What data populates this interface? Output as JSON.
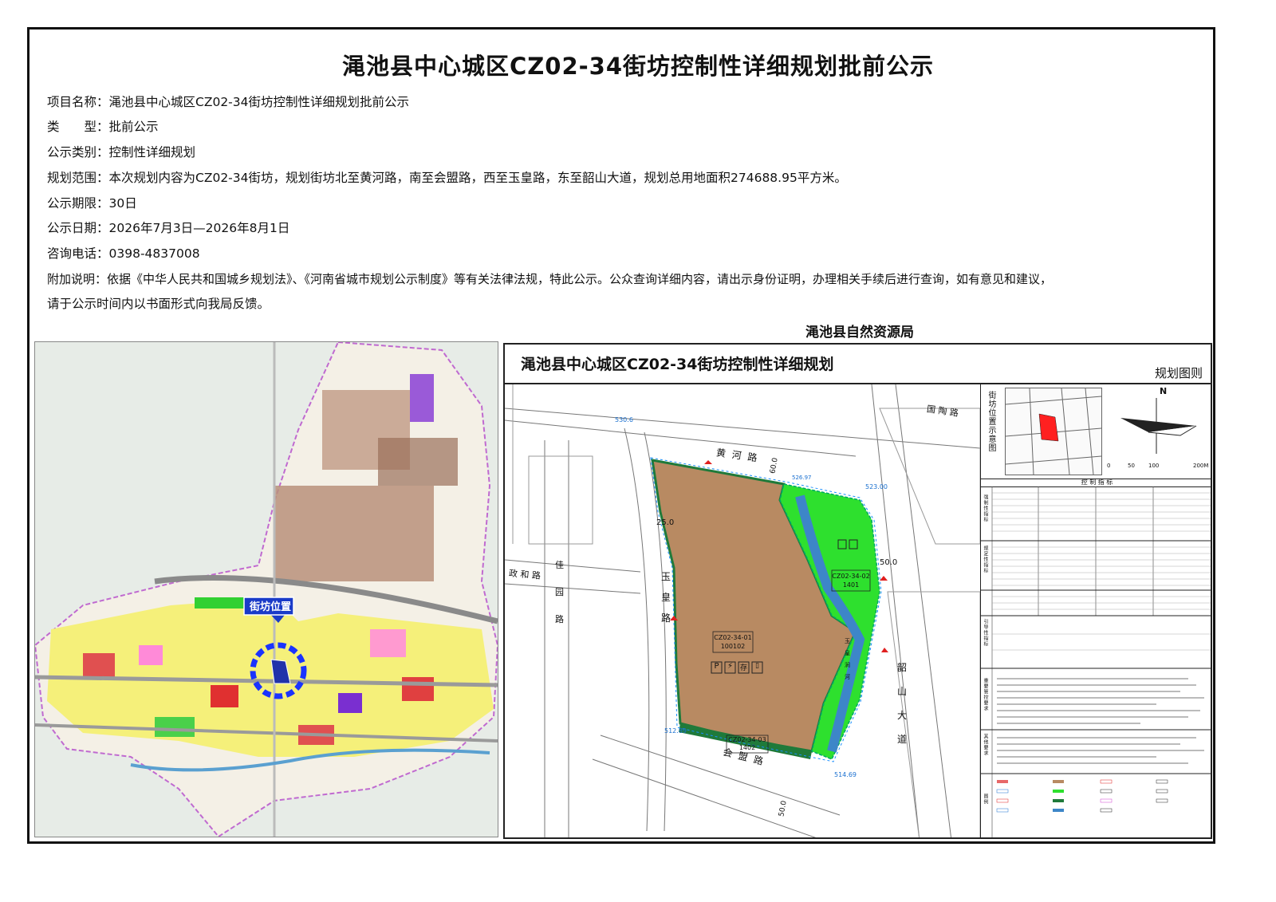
{
  "title": "渑池县中心城区CZ02-34街坊控制性详细规划批前公示",
  "info": [
    {
      "label": "项目名称：",
      "value": "渑池县中心城区CZ02-34街坊控制性详细规划批前公示"
    },
    {
      "label": "类　　型：",
      "value": "批前公示"
    },
    {
      "label": "公示类别：",
      "value": "控制性详细规划"
    },
    {
      "label": "规划范围：",
      "value": "本次规划内容为CZ02-34街坊，规划街坊北至黄河路，南至会盟路，西至玉皇路，东至韶山大道，规划总用地面积274688.95平方米。"
    },
    {
      "label": "公示期限：",
      "value": "30日"
    },
    {
      "label": "公示日期：",
      "value": "2026年7月3日—2026年8月1日"
    },
    {
      "label": "咨询电话：",
      "value": "0398-4837008"
    },
    {
      "label": "附加说明：",
      "value": "依据《中华人民共和国城乡规划法》、《河南省城市规划公示制度》等有关法律法规，特此公示。公众查询详细内容，请出示身份证明，办理相关手续后进行查询，如有意见和建议，"
    },
    {
      "label": "",
      "value": "请于公示时间内以书面形式向我局反馈。"
    }
  ],
  "authority": "渑池县自然资源局",
  "location_map": {
    "label": "街坊位置"
  },
  "panel": {
    "title": "渑池县中心城区CZ02-34街坊控制性详细规划",
    "subtitle": "规划图则",
    "roads": {
      "north": "黄 河 路",
      "south": "会 盟 路",
      "west": "玉 皇 路",
      "east": "韶 山 大 道",
      "northeast": "国 陶 路",
      "west_road": "政 和 路",
      "west_vertical": "佳 园 路",
      "river": "玉 皇 涧 河"
    },
    "widths": {
      "north": "60.0",
      "east": "50.0",
      "west": "25.0",
      "south": "50.0"
    },
    "elevations": [
      "530.6",
      "523.00",
      "512.89",
      "514.69",
      "526.97"
    ],
    "parcels": [
      {
        "code": "CZ02-34-01",
        "use": "100102"
      },
      {
        "code": "CZ02-34-02",
        "use": "1401"
      },
      {
        "code": "CZ02-34-03",
        "use": "1402"
      }
    ],
    "facility_icons": [
      "P",
      "⚡",
      "存",
      "▯"
    ],
    "side": {
      "locator_title": "街坊位置示意图",
      "north": "N",
      "scale": [
        "0",
        "50",
        "100",
        "200M"
      ],
      "table_title": "控 制 指 标",
      "sections": [
        "强制性指标",
        "规定性指标",
        "引导性指标",
        "重要管控要求",
        "其他要求",
        "图例"
      ]
    }
  },
  "colors": {
    "residential": "#b88a62",
    "green": "#2ee02e",
    "river": "#3d86c8",
    "dark_green": "#1f7a3a",
    "locator_red": "#ff2020",
    "highlight": "#1a33ff"
  }
}
